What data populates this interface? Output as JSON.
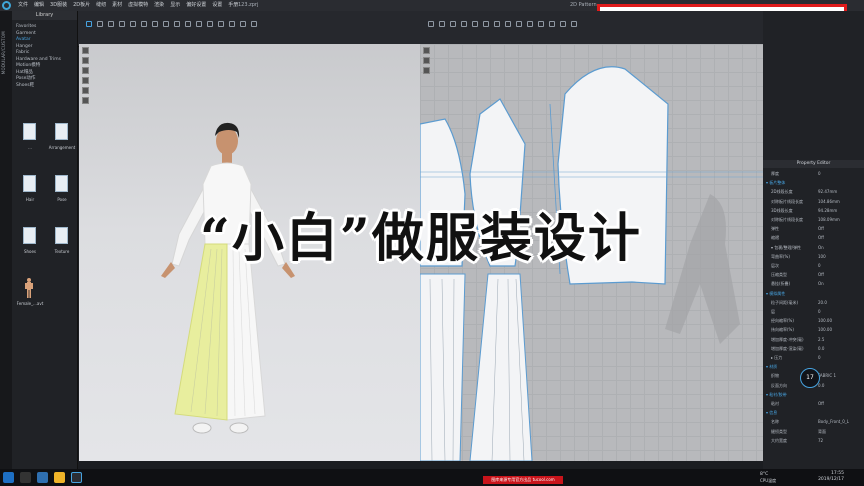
{
  "menu": [
    "文件",
    "编辑",
    "3D服装",
    "2D板片",
    "缝纫",
    "素材",
    "虚拟模特",
    "渲染",
    "显示",
    "偏好设置",
    "设置",
    "手册"
  ],
  "file_tab": "123.zprj",
  "right_tab": "2D Pattern",
  "left_strip": "MODULAR/CUSTOM",
  "library": {
    "title": "Library",
    "items": [
      "Favorites",
      "Garment",
      "Avatar",
      "Hanger",
      "Fabric",
      "Hardware and Trims",
      "Motion模特",
      "Hat帽品",
      "Pose动作",
      "Shoes鞋"
    ],
    "active_index": 2,
    "tiles": [
      "...",
      "Arrangement",
      "Hair",
      "Pose",
      "Shoes",
      "Texture",
      "Female_...avt"
    ]
  },
  "version": "Version: 5.0.188 (r36795)",
  "headline": "“小白”做服装设计",
  "brand": "图休服装设计有限公司",
  "property_editor": {
    "title": "Property Editor",
    "rows": [
      {
        "k": "厚度",
        "v": "0",
        "sec": false
      },
      {
        "k": "▾ 板片整体",
        "v": "",
        "sec": true
      },
      {
        "k": "2D线段长度",
        "v": "92.47mm",
        "sec": false
      },
      {
        "k": "对称板片线段长度",
        "v": "104.86mm",
        "sec": false
      },
      {
        "k": "3D线段长度",
        "v": "94.28mm",
        "sec": false
      },
      {
        "k": "对称板片线段长度",
        "v": "108.09mm",
        "sec": false
      },
      {
        "k": "弹性",
        "v": "Off",
        "sec": false
      },
      {
        "k": "缩褶",
        "v": "Off",
        "sec": false
      },
      {
        "k": "▾ 包裹/整理/弹性",
        "v": "On",
        "sec": false
      },
      {
        "k": "弯曲率(%)",
        "v": "100",
        "sec": false
      },
      {
        "k": "层次",
        "v": "0",
        "sec": false
      },
      {
        "k": "压缩类型",
        "v": "Off",
        "sec": false
      },
      {
        "k": "悬挂(折叠)",
        "v": "On",
        "sec": false
      },
      {
        "k": "▾ 模拟属性",
        "v": "",
        "sec": true
      },
      {
        "k": "粒子间距(毫米)",
        "v": "20.0",
        "sec": false
      },
      {
        "k": "层",
        "v": "0",
        "sec": false
      },
      {
        "k": "经向缩率(%)",
        "v": "100.00",
        "sec": false
      },
      {
        "k": "纬向缩率(%)",
        "v": "100.00",
        "sec": false
      },
      {
        "k": "增加厚度-冲突(毫)",
        "v": "2.5",
        "sec": false
      },
      {
        "k": "增加厚度-渲染(毫)",
        "v": "0.0",
        "sec": false
      },
      {
        "k": "▸ 压力",
        "v": "0",
        "sec": false
      },
      {
        "k": "▾ 材质",
        "v": "",
        "sec": true
      },
      {
        "k": "织物",
        "v": "FABRIC 1",
        "sec": false
      },
      {
        "k": "反面方向",
        "v": "0.0",
        "sec": false
      },
      {
        "k": "▾ 粘衬/胶带",
        "v": "",
        "sec": true
      },
      {
        "k": "粘衬",
        "v": "Off",
        "sec": false
      },
      {
        "k": "▾ 信息",
        "v": "",
        "sec": true
      },
      {
        "k": "名称",
        "v": "Body_Front_0_L",
        "sec": false
      },
      {
        "k": "缝纫类型",
        "v": "背面",
        "sec": false
      },
      {
        "k": "大约宽度",
        "v": "72",
        "sec": false
      }
    ]
  },
  "stats_badge": "17",
  "watermark": "图库来源专用官方出品 tucool.com",
  "clock": {
    "time": "17:55",
    "date": "2019/12/17"
  },
  "weather": "8°C",
  "cpu": "CPU温度",
  "colors": {
    "accent": "#47a3e0",
    "brand_red": "#e01b1b",
    "skirt": "#e8ee9e"
  }
}
